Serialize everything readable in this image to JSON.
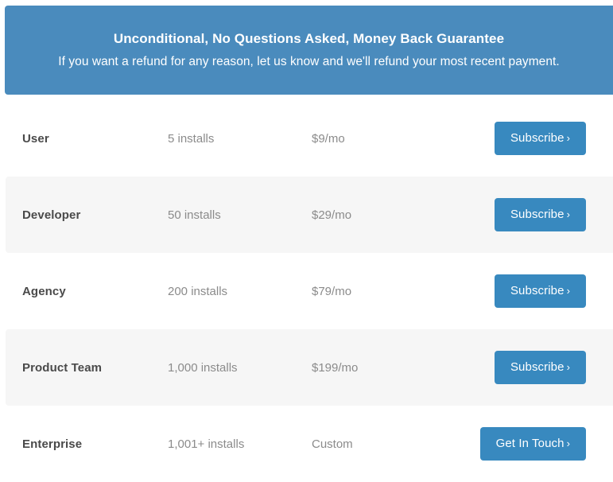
{
  "banner": {
    "title": "Unconditional, No Questions Asked, Money Back Guarantee",
    "subtitle": "If you want a refund for any reason, let us know and we'll refund your most recent payment.",
    "background_color": "#4a8bbd",
    "text_color": "#ffffff"
  },
  "plans": [
    {
      "name": "User",
      "installs": "5 installs",
      "price": "$9/mo",
      "cta_label": "Subscribe",
      "cta_chevron": "›",
      "striped": false
    },
    {
      "name": "Developer",
      "installs": "50 installs",
      "price": "$29/mo",
      "cta_label": "Subscribe",
      "cta_chevron": "›",
      "striped": true
    },
    {
      "name": "Agency",
      "installs": "200 installs",
      "price": "$79/mo",
      "cta_label": "Subscribe",
      "cta_chevron": "›",
      "striped": false
    },
    {
      "name": "Product Team",
      "installs": "1,000 installs",
      "price": "$199/mo",
      "cta_label": "Subscribe",
      "cta_chevron": "›",
      "striped": true
    },
    {
      "name": "Enterprise",
      "installs": "1,001+ installs",
      "price": "Custom",
      "cta_label": "Get In Touch",
      "cta_chevron": "›",
      "striped": false
    }
  ],
  "colors": {
    "accent": "#3889bf",
    "banner": "#4a8bbd",
    "stripe": "#f6f6f6",
    "name_text": "#4a4a4a",
    "muted_text": "#8b8b8b"
  }
}
